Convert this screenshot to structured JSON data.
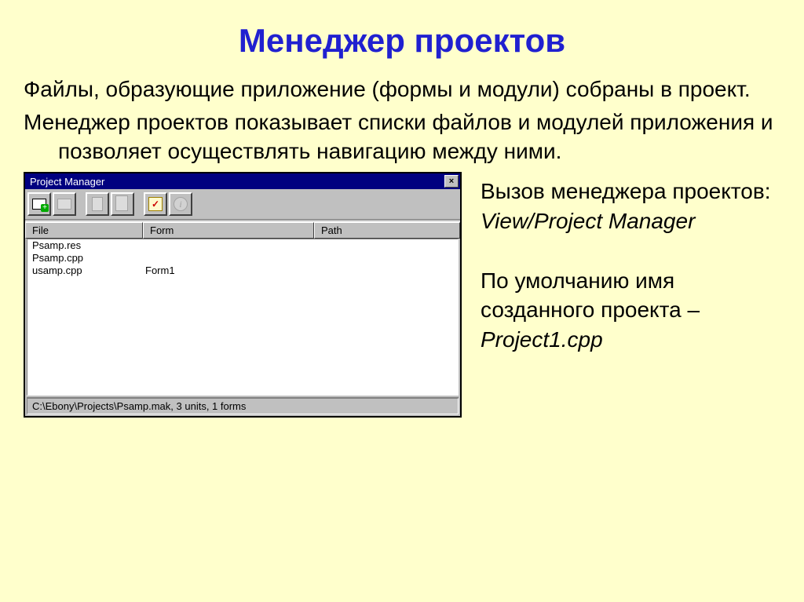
{
  "slide": {
    "title": "Менеджер проектов",
    "p1": "Файлы, образующие приложение (формы и модули) собраны в проект.",
    "p2": "Менеджер проектов показывает списки файлов и модулей приложения и позволяет осуществлять навигацию между ними.",
    "side1": "Вызов менеджера проектов:",
    "side1_ital": "View/Project Manager",
    "side2": "По умолчанию имя созданного проекта – ",
    "side2_ital": "Project1.cpp"
  },
  "pm": {
    "title": "Project Manager",
    "headers": {
      "file": "File",
      "form": "Form",
      "path": "Path"
    },
    "rows": [
      {
        "file": "Psamp.res",
        "form": "",
        "path": ""
      },
      {
        "file": "Psamp.cpp",
        "form": "",
        "path": ""
      },
      {
        "file": "usamp.cpp",
        "form": "Form1",
        "path": ""
      }
    ],
    "status": "C:\\Ebony\\Projects\\Psamp.mak, 3 units, 1 forms",
    "icon_check": "✓",
    "icon_help": "i",
    "icon_close": "×"
  }
}
